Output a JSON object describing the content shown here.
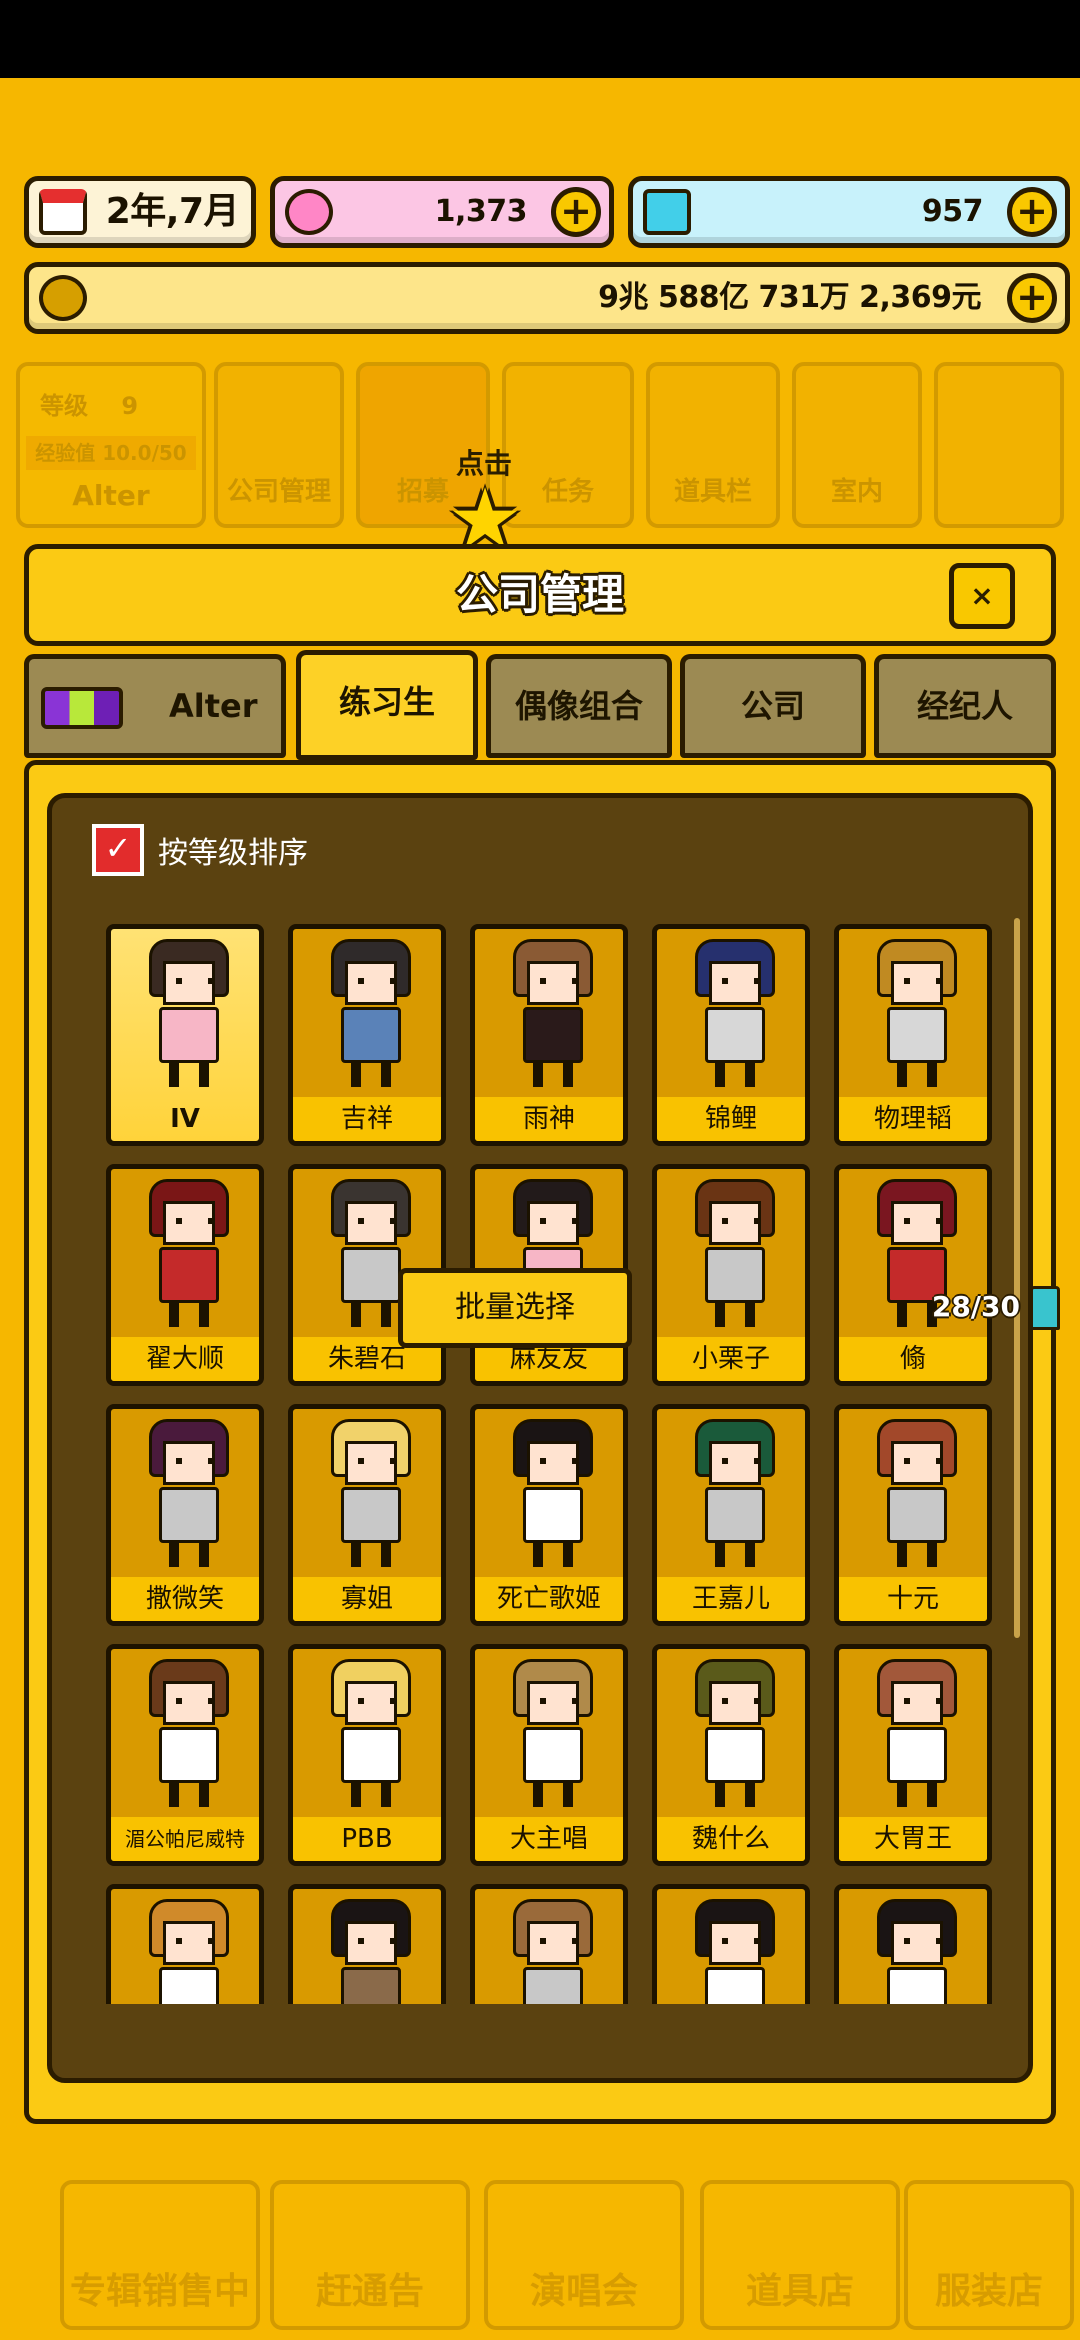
{
  "resources": {
    "date": "2年,7月",
    "gems": "1,373",
    "diamonds": "957",
    "money": "9兆 588亿 731万 2,369元",
    "plus": "+"
  },
  "background_menu": {
    "level_label": "等级",
    "level_value": "9",
    "exp_label": "经验值 10.0/50",
    "group_name": "Alter",
    "company_mgmt": "公司管理",
    "recruit": "招募",
    "task": "任务",
    "items": "道具栏",
    "interior": "室内"
  },
  "tap_hint": "点击",
  "dialog": {
    "title": "公司管理",
    "close": "×",
    "tabs": [
      "Alter",
      "练习生",
      "偶像组合",
      "公司",
      "经纪人"
    ],
    "active_tab": "练习生",
    "sort_label": "按等级排序",
    "batch_select": "批量选择",
    "count": "28/30"
  },
  "trainees": [
    {
      "name": "IV",
      "hair": "#3a2a22",
      "outfit": "#f7b6c6",
      "selected": true
    },
    {
      "name": "吉祥",
      "hair": "#2f2a2a",
      "outfit": "#5a82b8"
    },
    {
      "name": "雨神",
      "hair": "#8a5a34",
      "outfit": "#2a1a1a"
    },
    {
      "name": "锦鲤",
      "hair": "#26306e",
      "outfit": "#d7d7d7"
    },
    {
      "name": "物理韬",
      "hair": "#c08a22",
      "outfit": "#d7d7d7"
    },
    {
      "name": "翟大顺",
      "hair": "#7a1616",
      "outfit": "#c42a2a"
    },
    {
      "name": "朱碧石",
      "hair": "#3a3430",
      "outfit": "#c8c8c8"
    },
    {
      "name": "麻友友",
      "hair": "#221a1a",
      "outfit": "#f7b6c6"
    },
    {
      "name": "小栗子",
      "hair": "#6a3414",
      "outfit": "#c8c8c8"
    },
    {
      "name": "翛",
      "hair": "#7a1620",
      "outfit": "#c42a2a"
    },
    {
      "name": "撒微笑",
      "hair": "#4a1a3c",
      "outfit": "#c8c8c8"
    },
    {
      "name": "寡姐",
      "hair": "#f1d26a",
      "outfit": "#c8c8c8"
    },
    {
      "name": "死亡歌姬",
      "hair": "#1a1414",
      "outfit": "#ffffff"
    },
    {
      "name": "王嘉儿",
      "hair": "#1a5a3a",
      "outfit": "#c8c8c8"
    },
    {
      "name": "十元",
      "hair": "#a2482a",
      "outfit": "#c8c8c8"
    },
    {
      "name": "湄公帕尼威特",
      "hair": "#6a3a1a",
      "outfit": "#ffffff"
    },
    {
      "name": "PBB",
      "hair": "#f0d060",
      "outfit": "#ffffff"
    },
    {
      "name": "大主唱",
      "hair": "#b08a4a",
      "outfit": "#ffffff"
    },
    {
      "name": "魏什么",
      "hair": "#5a5a1a",
      "outfit": "#ffffff"
    },
    {
      "name": "大胃王",
      "hair": "#a2583a",
      "outfit": "#ffffff"
    },
    {
      "name": "",
      "hair": "#d08a2a",
      "outfit": "#ffffff"
    },
    {
      "name": "",
      "hair": "#1a1414",
      "outfit": "#8a6a4a"
    },
    {
      "name": "",
      "hair": "#9a6a3a",
      "outfit": "#c8c8c8"
    },
    {
      "name": "",
      "hair": "#1a1414",
      "outfit": "#ffffff"
    },
    {
      "name": "",
      "hair": "#1a1414",
      "outfit": "#ffffff"
    }
  ],
  "bottom_nav": [
    "专辑销售中",
    "赶通告",
    "演唱会",
    "道具店",
    "服装店"
  ],
  "colors": {
    "background": "#f6b700",
    "panel": "#fbca14",
    "inner_panel": "#5b4210",
    "card": "#d99a00",
    "sort_check": "#e22c2c"
  }
}
